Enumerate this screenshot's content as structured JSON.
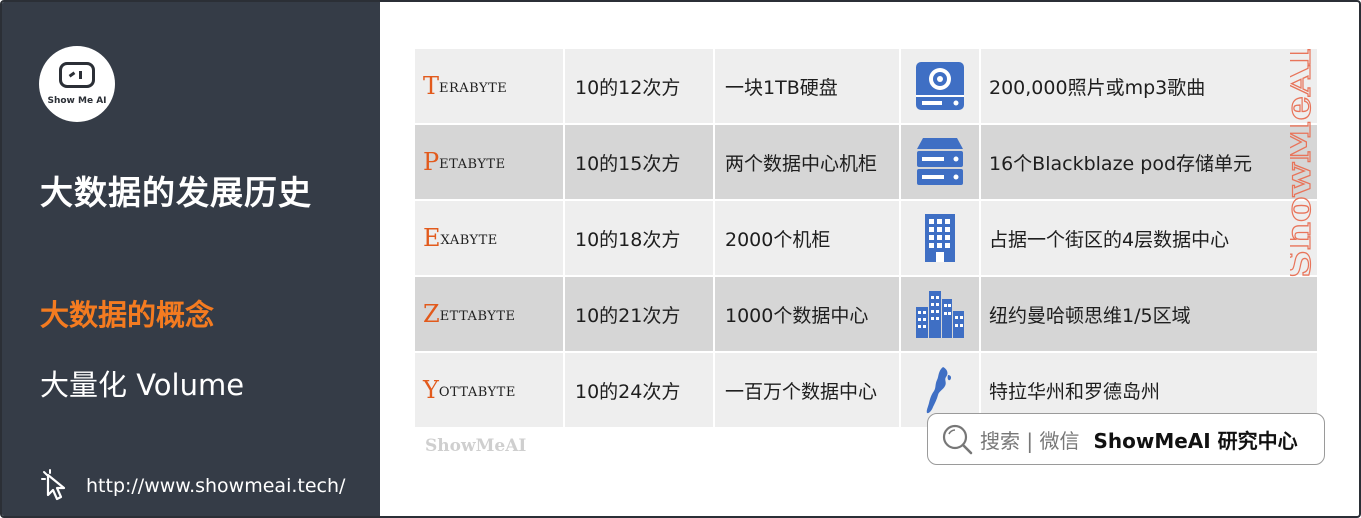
{
  "sidebar": {
    "logo_text": "Show Me AI",
    "title": "大数据的发展历史",
    "concept": "大数据的概念",
    "volume": "大量化 Volume",
    "url": "http://www.showmeai.tech/"
  },
  "table": {
    "rows": [
      {
        "unit_first": "T",
        "unit_rest": "erabyte",
        "power": "10的12次方",
        "example": "一块1TB硬盘",
        "icon": "hard-drive-icon",
        "equivalent": "200,000照片或mp3歌曲"
      },
      {
        "unit_first": "P",
        "unit_rest": "etabyte",
        "power": "10的15次方",
        "example": "两个数据中心机柜",
        "icon": "server-rack-icon",
        "equivalent": "16个Blackblaze pod存储单元"
      },
      {
        "unit_first": "E",
        "unit_rest": "xabyte",
        "power": "10的18次方",
        "example": "2000个机柜",
        "icon": "building-icon",
        "equivalent": "占据一个街区的4层数据中心"
      },
      {
        "unit_first": "Z",
        "unit_rest": "ettabyte",
        "power": "10的21次方",
        "example": "1000个数据中心",
        "icon": "city-icon",
        "equivalent": "纽约曼哈顿思维1/5区域"
      },
      {
        "unit_first": "Y",
        "unit_rest": "ottabyte",
        "power": "10的24次方",
        "example": "一百万个数据中心",
        "icon": "island-map-icon",
        "equivalent": "特拉华州和罗德岛州"
      }
    ]
  },
  "watermark": {
    "small": "ShowMeAI",
    "vertical": "ShowMeAI"
  },
  "search": {
    "label": "搜索 | 微信",
    "brand": "ShowMeAI 研究中心"
  },
  "colors": {
    "sidebar_bg": "#353c47",
    "accent": "#f47b20",
    "unit_letter": "#e25a1c",
    "icon_blue": "#3f6fc4",
    "row_gray": "#d6d6d6",
    "row_light": "#eeeeee"
  }
}
